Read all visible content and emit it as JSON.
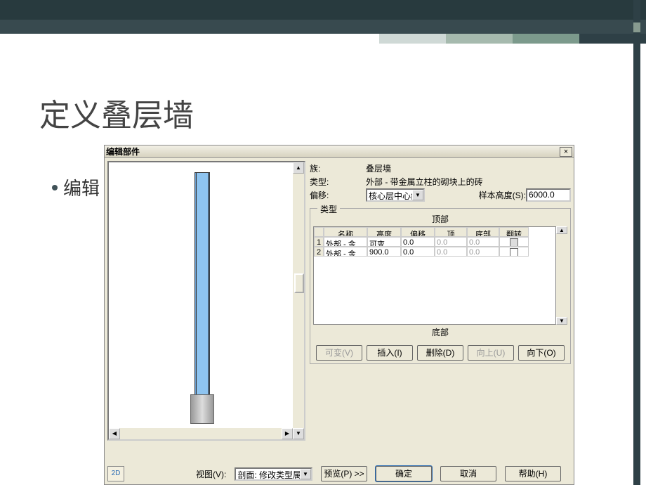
{
  "slide": {
    "title": "定义叠层墙",
    "bullet": "编辑"
  },
  "dialog": {
    "title": "编辑部件",
    "close_x": "×",
    "family_label": "族:",
    "family_value": "叠层墙",
    "type_label": "类型:",
    "type_value": "外部 - 带金属立柱的砌块上的砖",
    "offset_label": "偏移:",
    "offset_value": "核心层中心线",
    "sample_height_label": "样本高度(S):",
    "sample_height_value": "6000.0",
    "fieldset_label": "类型",
    "top_label": "顶部",
    "bottom_label": "底部",
    "columns": [
      "名称",
      "高度",
      "偏移",
      "顶",
      "底部",
      "翻转"
    ],
    "rows": [
      {
        "idx": "1",
        "name": "外部 - 金",
        "height": "可变",
        "offset": "0.0",
        "top": "0.0",
        "bottom": "0.0",
        "flip": "checked"
      },
      {
        "idx": "2",
        "name": "外部 - 金",
        "height": "900.0",
        "offset": "0.0",
        "top": "0.0",
        "bottom": "0.0",
        "flip": ""
      }
    ],
    "btn_variable": "可变(V)",
    "btn_insert": "插入(I)",
    "btn_delete": "删除(D)",
    "btn_up": "向上(U)",
    "btn_down": "向下(O)",
    "view_label": "视图(V):",
    "view_value": "剖面: 修改类型属性",
    "btn_preview": "预览(P) >>",
    "btn_ok": "确定",
    "btn_cancel": "取消",
    "btn_help": "帮助(H)",
    "icon2d": "2D"
  }
}
